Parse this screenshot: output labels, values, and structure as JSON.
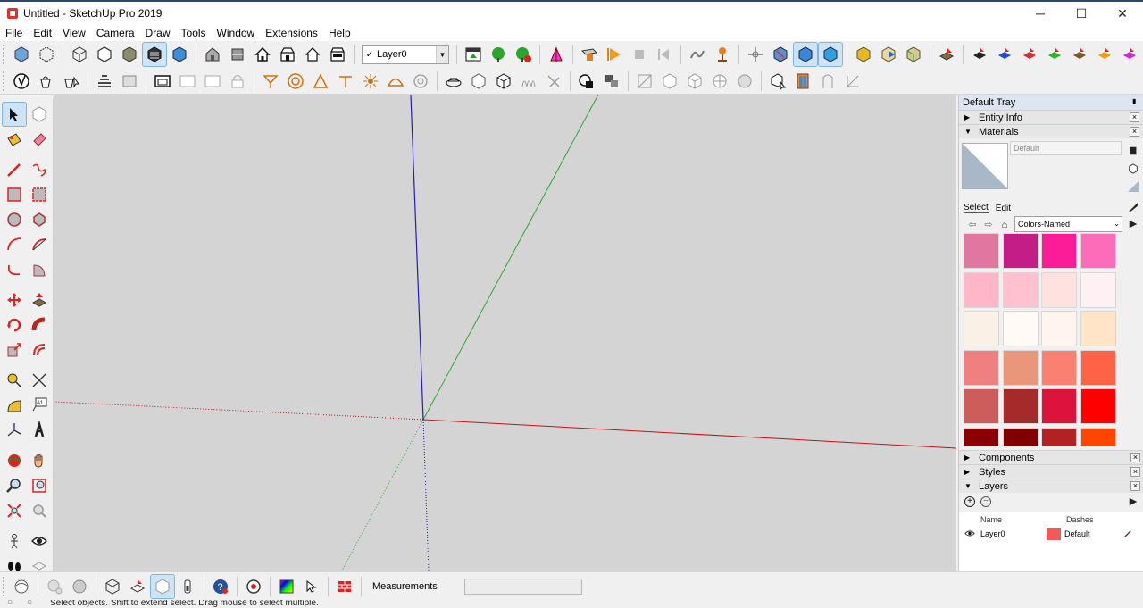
{
  "window": {
    "title": "Untitled - SketchUp Pro 2019",
    "minimize": "─",
    "maximize": "☐",
    "close": "✕"
  },
  "menu": [
    "File",
    "Edit",
    "View",
    "Camera",
    "Draw",
    "Tools",
    "Window",
    "Extensions",
    "Help"
  ],
  "layer_toolbar": {
    "current_layer": "Layer0",
    "check": "✓"
  },
  "tray": {
    "title": "Default Tray",
    "panels": {
      "entity_info": "Entity Info",
      "materials": "Materials",
      "components": "Components",
      "styles": "Styles",
      "layers": "Layers"
    },
    "materials": {
      "current_name": "Default",
      "tabs": {
        "select": "Select",
        "edit": "Edit"
      },
      "collection": "Colors-Named",
      "swatch_colors": [
        "#df77a0",
        "#c41d85",
        "#fd1c97",
        "#fd6cb9",
        "#ffb7c8",
        "#ffc0cf",
        "#ffe2e0",
        "#fff0f3",
        "#faf0e6",
        "#fffaf6",
        "#fff5ee",
        "#ffe4c7",
        "#f08080",
        "#e9967a",
        "#fa8072",
        "#ff6347",
        "#cd5c5c",
        "#a52a2a",
        "#dc143c",
        "#ff0000",
        "#8b0000",
        "#800000",
        "#b22222",
        "#ff4500"
      ]
    },
    "layers": {
      "col_name": "Name",
      "col_dashes": "Dashes",
      "rows": [
        {
          "name": "Layer0",
          "color": "#f25a5a",
          "dashes": "Default"
        }
      ]
    }
  },
  "status": {
    "measurements_label": "Measurements",
    "measurements_value": "",
    "hint": "Select objects. Shift to extend select. Drag mouse to select multiple."
  },
  "colors": {
    "axis_red": "#c01414",
    "axis_green": "#2ea82e",
    "axis_blue": "#2020b0",
    "viewport_bg": "#d4d4d4"
  }
}
